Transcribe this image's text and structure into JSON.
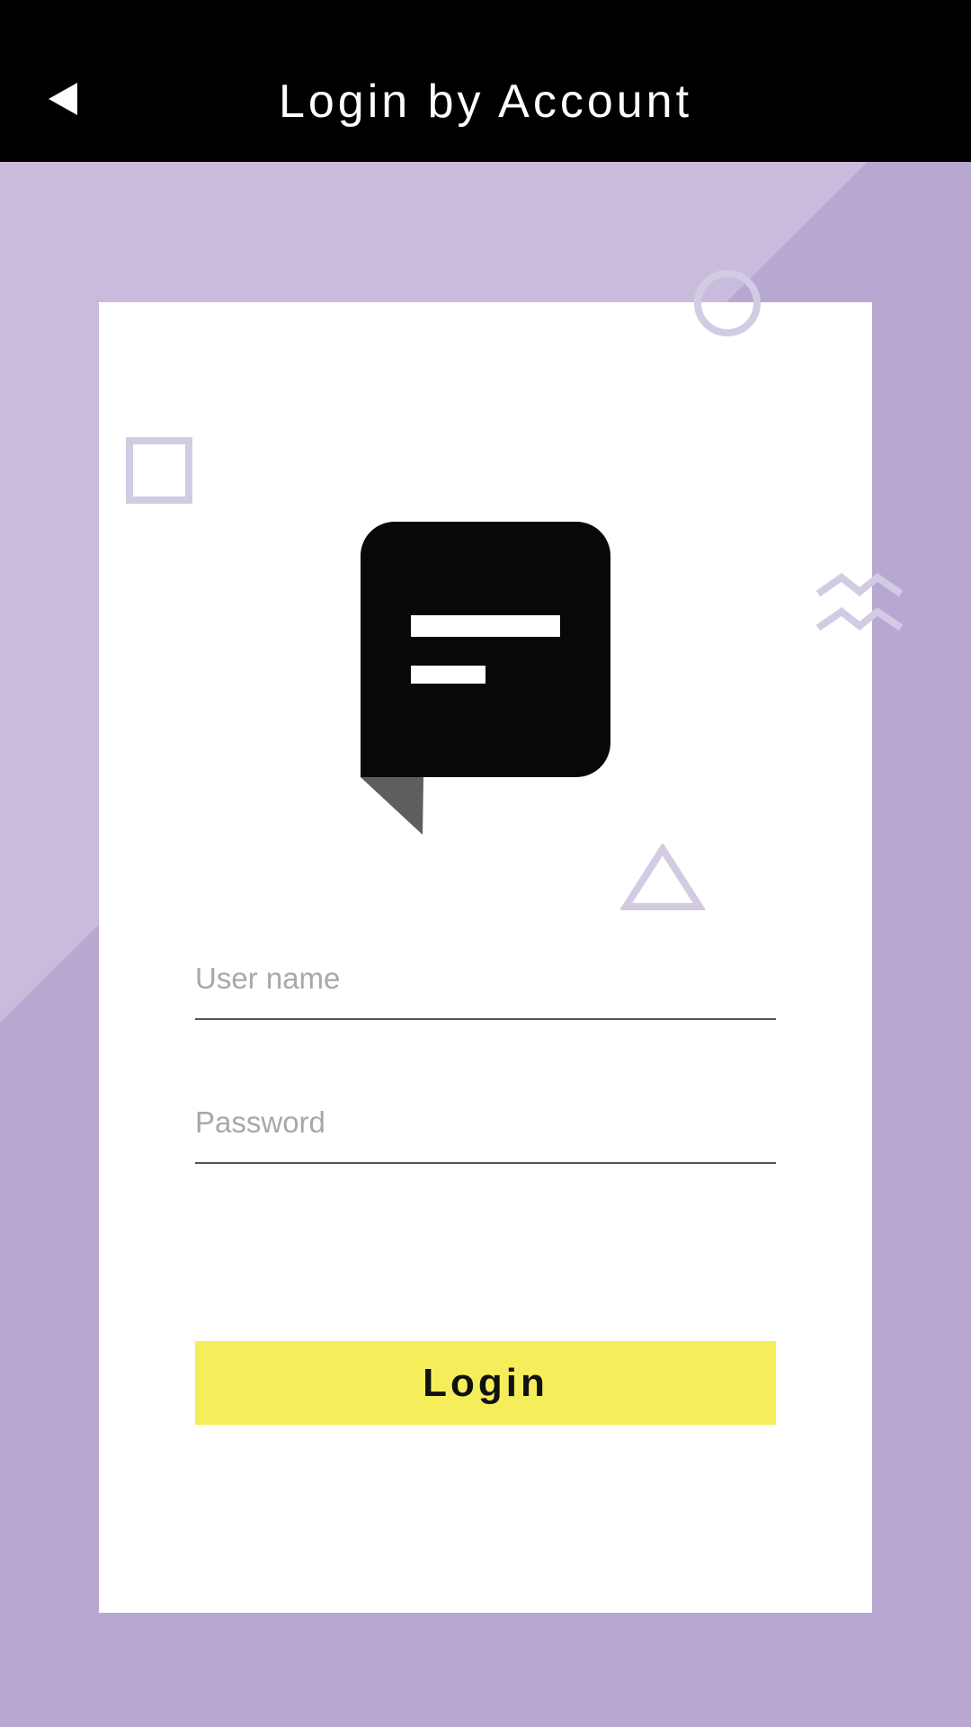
{
  "header": {
    "title": "Login by Account",
    "back_icon": "back-arrow-icon"
  },
  "form": {
    "username_placeholder": "User name",
    "password_placeholder": "Password",
    "login_label": "Login"
  },
  "colors": {
    "background": "#b8a8d1",
    "background_light": "#c9bbdb",
    "header": "#000000",
    "card": "#ffffff",
    "accent_button": "#f5ee5a",
    "decoration": "#d2cbe3",
    "logo": "#070909"
  },
  "icons": {
    "logo": "chat-bubble-icon",
    "decorations": [
      "circle-outline-icon",
      "square-outline-icon",
      "zigzag-icon",
      "triangle-outline-icon"
    ]
  }
}
